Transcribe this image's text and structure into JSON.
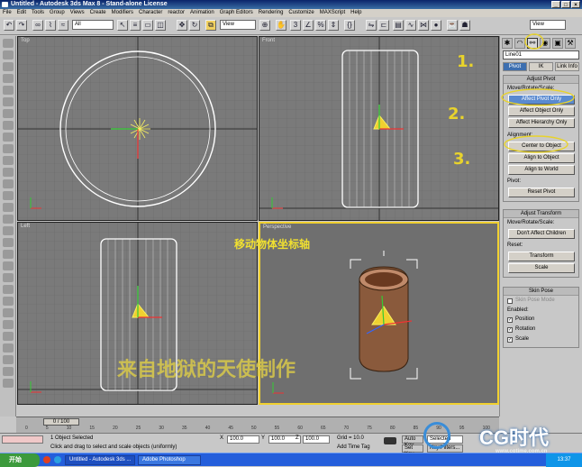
{
  "window": {
    "title": "Untitled - Autodesk 3ds Max 8 - Stand-alone License",
    "btns": [
      "_",
      "□",
      "×"
    ]
  },
  "menu": [
    "File",
    "Edit",
    "Tools",
    "Group",
    "Views",
    "Create",
    "Modifiers",
    "Character",
    "reactor",
    "Animation",
    "Graph Editors",
    "Rendering",
    "Customize",
    "MAXScript",
    "Help"
  ],
  "toolbar": {
    "filter": "All",
    "refsys": "View",
    "refsys2": "View"
  },
  "viewports": {
    "top": "Top",
    "front": "Front",
    "left": "Left",
    "persp": "Perspective"
  },
  "cmd": {
    "object": "Line01",
    "tabs": [
      "Pivot",
      "IK",
      "Link Info"
    ],
    "adjust_pivot": "Adjust Pivot",
    "move_rotate_scale": "Move/Rotate/Scale:",
    "affect_pivot": "Affect Pivot Only",
    "affect_object": "Affect Object Only",
    "affect_hierarchy": "Affect Hierarchy Only",
    "alignment": "Alignment:",
    "center": "Center to Object",
    "align_obj": "Align to Object",
    "align_world": "Align to World",
    "pivot": "Pivot:",
    "reset_pivot": "Reset Pivot",
    "adjust_transform": "Adjust Transform",
    "mrs2": "Move/Rotate/Scale:",
    "dont_affect": "Don't Affect Children",
    "reset": "Reset:",
    "transform": "Transform",
    "scale": "Scale",
    "skin_pose": "Skin Pose",
    "skin_mode": "Skin Pose Mode",
    "enabled": "Enabled:",
    "position": "Position",
    "rotation": "Rotation",
    "scale2": "Scale"
  },
  "annotations": {
    "n1": "1.",
    "n2": "2.",
    "n3": "3.",
    "move_axis": "移动物体坐标轴",
    "credit": "来自地狱的天使制作"
  },
  "timeline": {
    "frame": "0 / 100",
    "ticks": [
      "0",
      "5",
      "10",
      "15",
      "20",
      "25",
      "30",
      "35",
      "40",
      "45",
      "50",
      "55",
      "60",
      "65",
      "70",
      "75",
      "80",
      "85",
      "90",
      "95",
      "100"
    ]
  },
  "status": {
    "selected": "1 Object Selected",
    "prompt": "Click and drag to select and scale objects (uniformly)",
    "x": "100.0",
    "y": "100.0",
    "z": "100.0",
    "grid": "Grid = 10.0",
    "autokey": "Auto Key",
    "setkey": "Set Key",
    "addtime": "Add Time Tag",
    "keyfilters": "Key Filters...",
    "selected2": "Selected"
  },
  "taskbar": {
    "start": "开始",
    "tasks": [
      "Untitled - Autodesk 3ds ...",
      "Adobe Photoshop"
    ],
    "clock": "13:37"
  },
  "watermark": {
    "logo": "CG时代",
    "url": "www.cgtime.com.cn"
  }
}
